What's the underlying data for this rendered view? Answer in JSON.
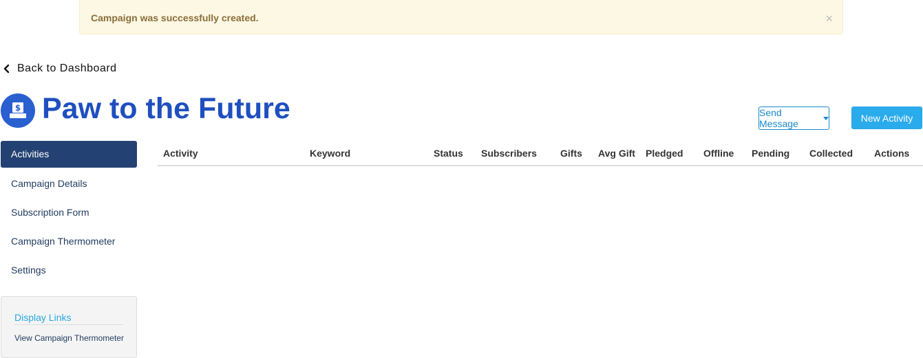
{
  "alert": {
    "message": "Campaign was successfully created.",
    "close": "×"
  },
  "back": {
    "label": "Back to Dashboard"
  },
  "campaign": {
    "title": "Paw to the Future"
  },
  "actions": {
    "send_message": "Send Message",
    "new_activity": "New Activity"
  },
  "sidebar": {
    "items": [
      {
        "label": "Activities",
        "active": true
      },
      {
        "label": "Campaign Details"
      },
      {
        "label": "Subscription Form"
      },
      {
        "label": "Campaign Thermometer"
      },
      {
        "label": "Settings"
      }
    ]
  },
  "display_links": {
    "title": "Display Links",
    "item": "View Campaign Thermometer"
  },
  "table": {
    "columns": [
      "Activity",
      "Keyword",
      "Status",
      "Subscribers",
      "Gifts",
      "Avg Gift",
      "Pledged",
      "Offline",
      "Pending",
      "Collected",
      "Actions"
    ],
    "rows": []
  },
  "colors": {
    "accent": "#1f4fbf",
    "nav_active": "#234273",
    "button_primary": "#2aabeb",
    "alert_bg": "#fcf8e3"
  }
}
